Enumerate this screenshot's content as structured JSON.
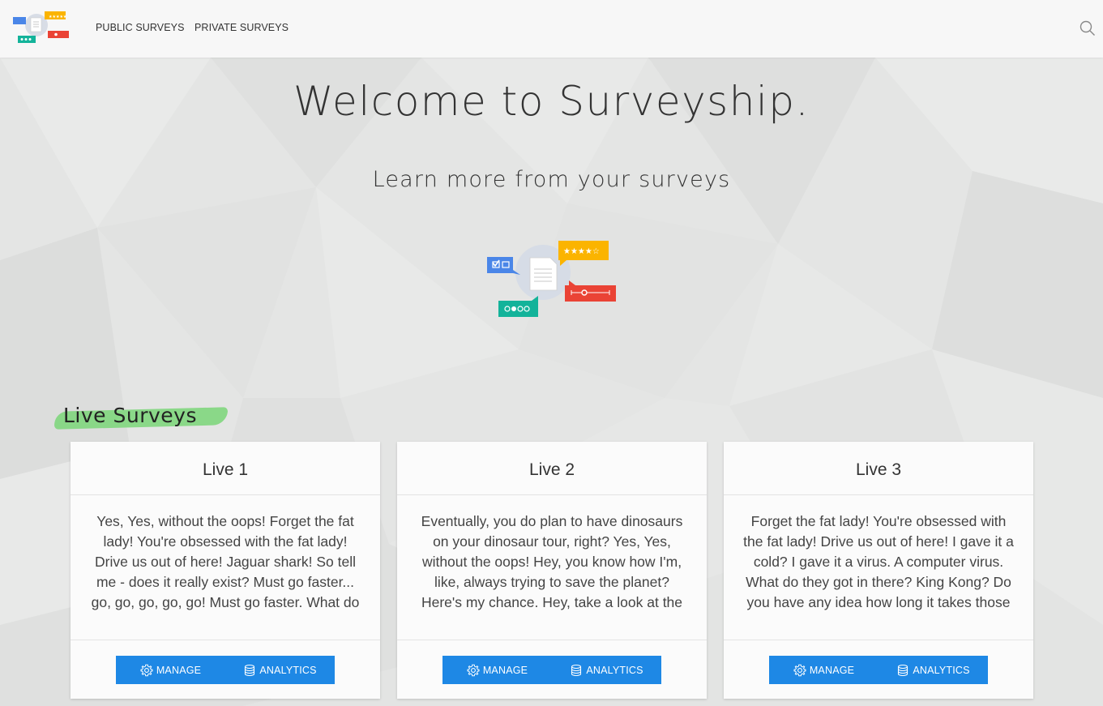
{
  "navbar": {
    "logo": "surveyship-logo",
    "links": [
      "PUBLIC SURVEYS",
      "PRIVATE SURVEYS"
    ],
    "search_icon": "search-icon"
  },
  "hero": {
    "title": "Welcome to Surveyship.",
    "subtitle": "Learn more from your surveys",
    "illustration": "survey-illustration"
  },
  "section": {
    "heading": "Live Surveys"
  },
  "cards": [
    {
      "title": "Live 1",
      "body": "Yes, Yes, without the oops! Forget the fat lady! You're obsessed with the fat lady! Drive us out of here! Jaguar shark! So tell me - does it really exist? Must go faster... go, go, go, go, go! Must go faster. What do they got in there? King Kong? Yeah, but",
      "manage_label": "MANAGE",
      "analytics_label": "ANALYTICS"
    },
    {
      "title": "Live 2",
      "body": "Eventually, you do plan to have dinosaurs on your dinosaur tour, right? Yes, Yes, without the oops! Hey, you know how I'm, like, always trying to save the planet? Here's my chance. Hey, take a look at the earthlings. Goodbye! Did he just throw my",
      "manage_label": "MANAGE",
      "analytics_label": "ANALYTICS"
    },
    {
      "title": "Live 3",
      "body": "Forget the fat lady! You're obsessed with the fat lady! Drive us out of here! I gave it a cold? I gave it a virus. A computer virus. What do they got in there? King Kong? Do you have any idea how long it takes those cups to decompose. Life finds a way.",
      "manage_label": "MANAGE",
      "analytics_label": "ANALYTICS"
    }
  ],
  "colors": {
    "button_blue": "#1e88e5",
    "highlight_green": "#7fd67d",
    "navbar_bg": "#f7f7f7",
    "page_bg": "#e5e6e5"
  }
}
